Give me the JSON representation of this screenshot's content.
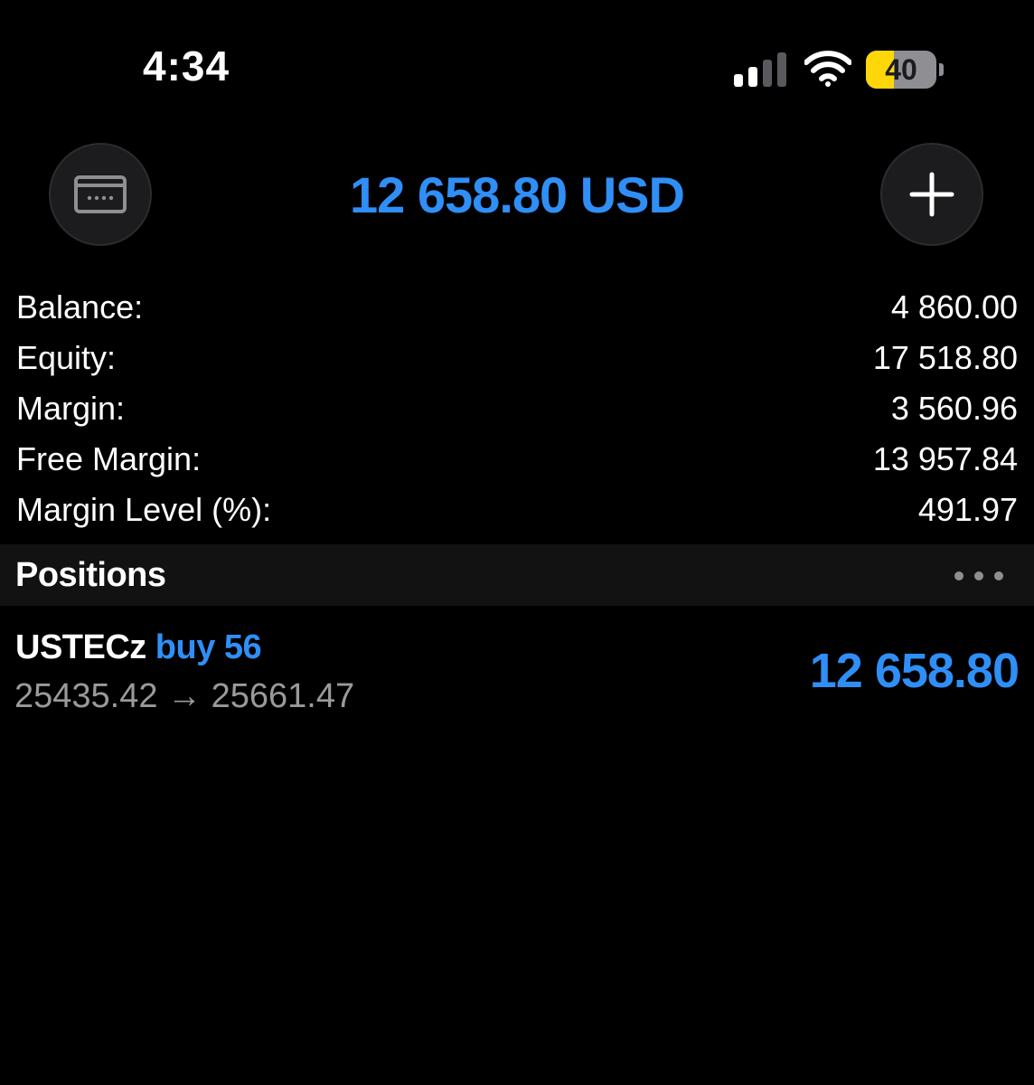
{
  "status_bar": {
    "time": "4:34",
    "battery_level": "40",
    "battery_fraction": 0.4,
    "signal_bars_active": 2,
    "signal_bars_total": 4
  },
  "header": {
    "left_icon": "card-icon",
    "title": "12 658.80 USD",
    "right_icon": "plus-icon"
  },
  "summary": [
    {
      "label": "Balance:",
      "value": "4 860.00"
    },
    {
      "label": "Equity:",
      "value": "17 518.80"
    },
    {
      "label": "Margin:",
      "value": "3 560.96"
    },
    {
      "label": "Free Margin:",
      "value": "13 957.84"
    },
    {
      "label": "Margin Level (%):",
      "value": "491.97"
    }
  ],
  "positions": {
    "title": "Positions",
    "menu_icon": "more-icon",
    "items": [
      {
        "symbol": "USTECz",
        "type": "buy 56",
        "prices": "25435.42 → 25661.47",
        "profit": "12 658.80"
      }
    ]
  },
  "colors": {
    "accent": "#2f8ff7",
    "background": "#000000",
    "muted_text": "#9a9a9a",
    "battery": "#ffd60a"
  }
}
